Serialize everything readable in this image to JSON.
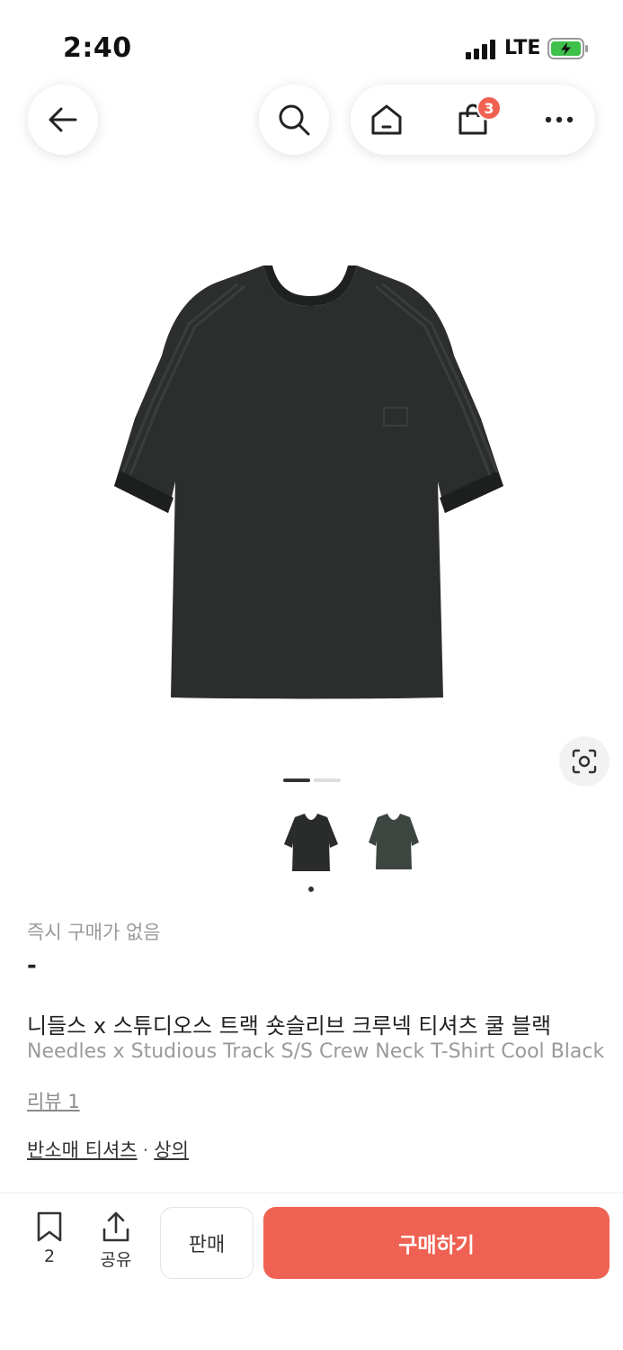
{
  "status_bar": {
    "time": "2:40",
    "network": "LTE"
  },
  "header": {
    "cart_count": "3"
  },
  "product": {
    "instant_purchase_label": "즉시 구매가 없음",
    "price": "-",
    "title_ko": "니들스 x 스튜디오스 트랙 숏슬리브 크루넥 티셔츠 쿨 블랙",
    "title_en": "Needles x Studious Track S/S Crew Neck T-Shirt Cool Black",
    "review_label": "리뷰 1",
    "category_primary": "반소매 티셔츠",
    "category_separator": "·",
    "category_secondary": "상의"
  },
  "bottom_bar": {
    "bookmark_count": "2",
    "share_label": "공유",
    "sell_label": "판매",
    "buy_label": "구매하기"
  },
  "colors": {
    "accent": "#ef6253",
    "badge": "#ef6253"
  }
}
